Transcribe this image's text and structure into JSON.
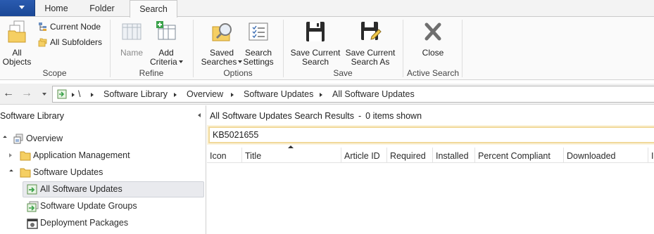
{
  "ribbon": {
    "tabs": [
      {
        "label": "Home",
        "active": false
      },
      {
        "label": "Folder",
        "active": false
      },
      {
        "label": "Search",
        "active": true
      }
    ],
    "groups": {
      "scope": {
        "title": "Scope",
        "all_objects": [
          "All",
          "Objects"
        ],
        "current_node": "Current Node",
        "all_subfolders": "All Subfolders"
      },
      "refine": {
        "title": "Refine",
        "name": "Name",
        "add_criteria": [
          "Add",
          "Criteria"
        ]
      },
      "options": {
        "title": "Options",
        "saved_searches": [
          "Saved",
          "Searches"
        ],
        "search_settings": [
          "Search",
          "Settings"
        ]
      },
      "save": {
        "title": "Save",
        "save_current_search": [
          "Save Current",
          "Search"
        ],
        "save_current_search_as": [
          "Save Current",
          "Search As"
        ]
      },
      "active_search": {
        "title": "Active Search",
        "close": "Close"
      }
    }
  },
  "address": {
    "root": "\\",
    "crumbs": [
      "Software Library",
      "Overview",
      "Software Updates",
      "All Software Updates"
    ]
  },
  "nav": {
    "header": "Software Library",
    "items": [
      {
        "label": "Overview",
        "icon": "overview-icon"
      },
      {
        "label": "Application Management",
        "icon": "folder-icon"
      },
      {
        "label": "Software Updates",
        "icon": "folder-icon"
      },
      {
        "label": "All Software Updates",
        "icon": "software-updates-icon",
        "selected": true
      },
      {
        "label": "Software Update Groups",
        "icon": "update-group-icon"
      },
      {
        "label": "Deployment Packages",
        "icon": "deployment-package-icon"
      }
    ]
  },
  "results": {
    "title": "All Software Updates Search Results",
    "separator": "-",
    "count_text": "0 items shown",
    "search_value": "KB5021655",
    "columns": [
      "Icon",
      "Title",
      "Article ID",
      "Required",
      "Installed",
      "Percent Compliant",
      "Downloaded",
      "I"
    ]
  },
  "colors": {
    "app_menu": "#1b4896",
    "search_highlight": "#f1d99a",
    "selected_row": "#e9eaee"
  }
}
